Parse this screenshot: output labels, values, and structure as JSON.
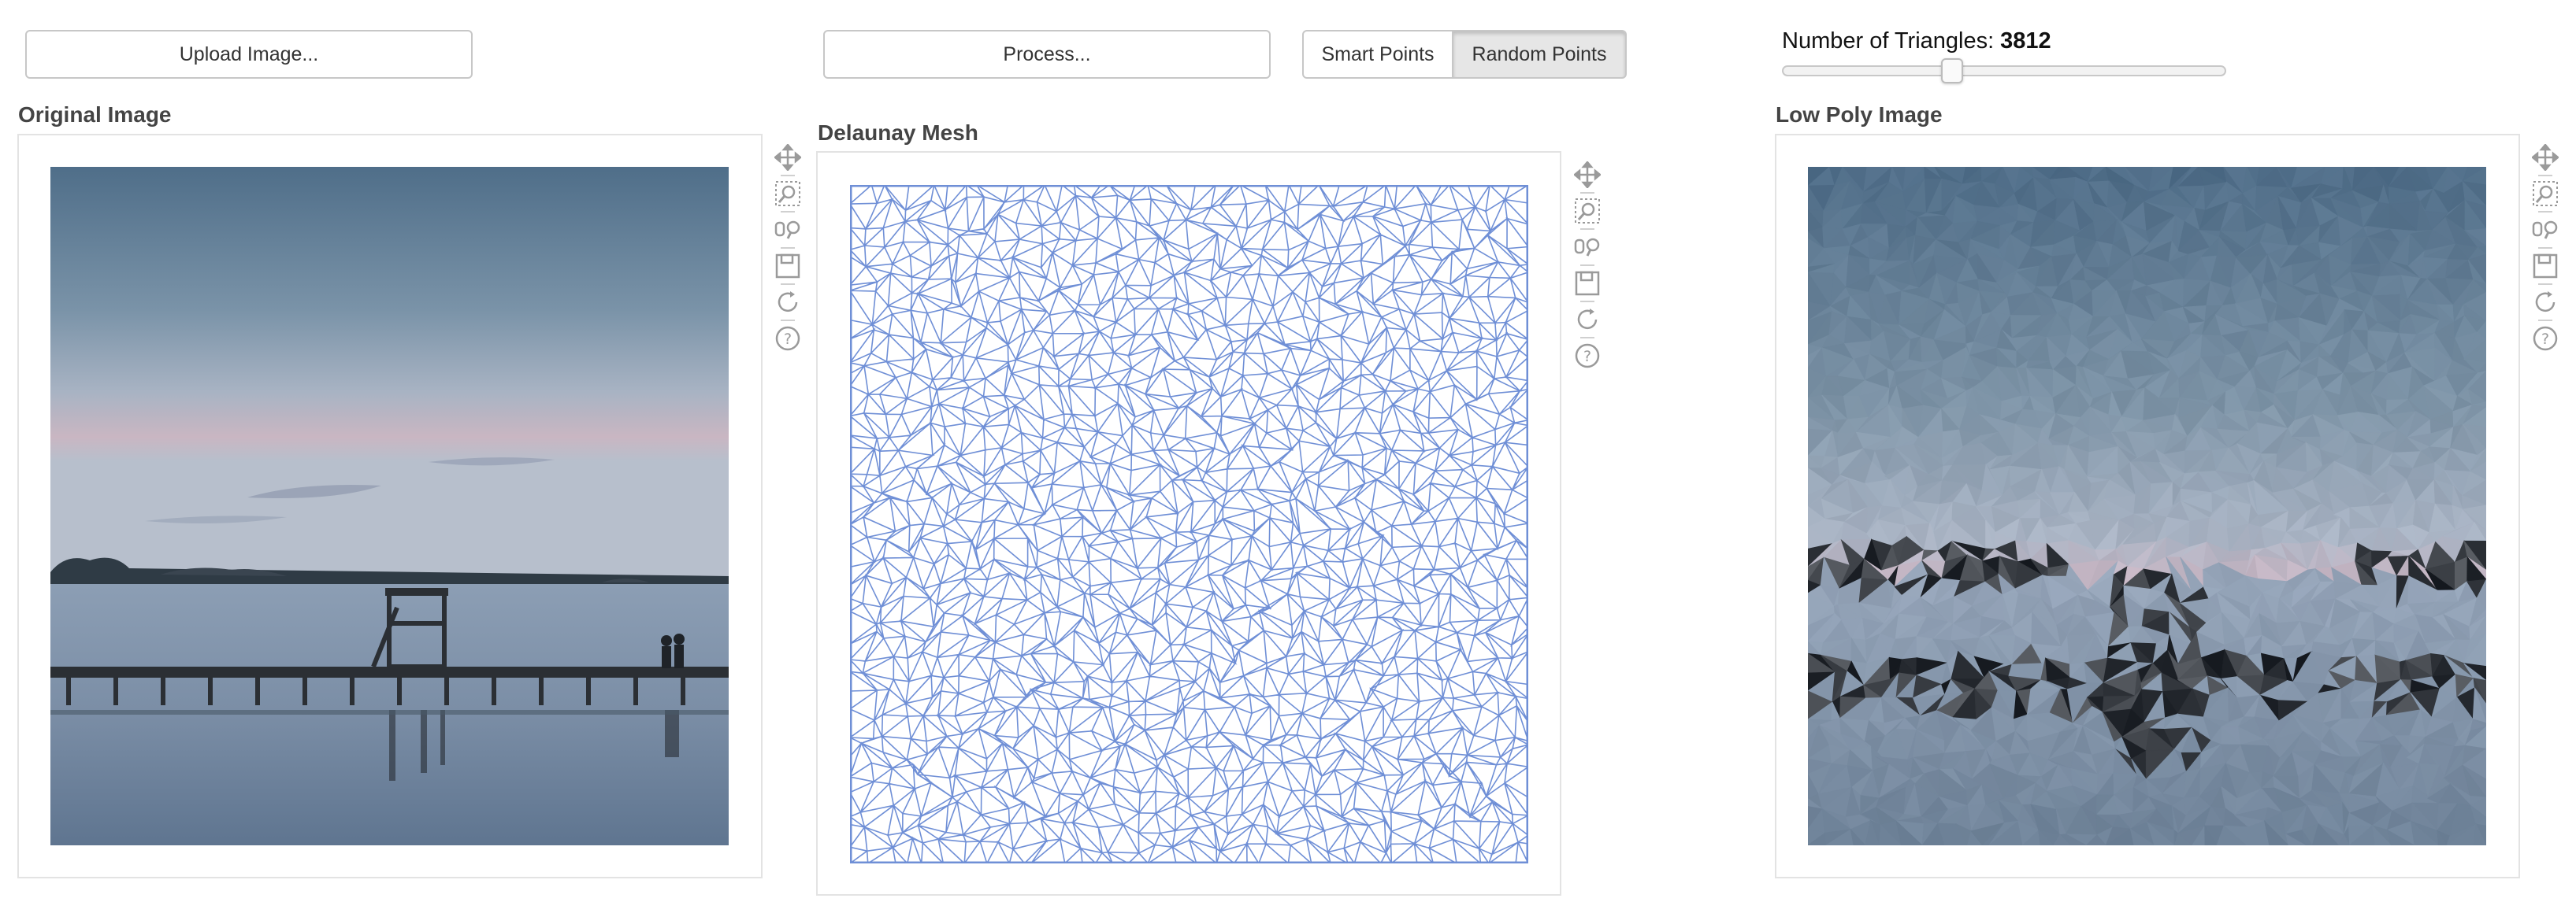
{
  "controls": {
    "upload_label": "Upload Image...",
    "process_label": "Process...",
    "point_modes": [
      "Smart Points",
      "Random Points"
    ],
    "selected_point_mode": "Random Points",
    "triangles_label": "Number of Triangles:",
    "triangles_value": "3812"
  },
  "panels": {
    "original_title": "Original Image",
    "mesh_title": "Delaunay Mesh",
    "lowpoly_title": "Low Poly Image"
  },
  "toolbar_icons": [
    "pan-icon",
    "box-zoom-icon",
    "wheel-zoom-icon",
    "save-icon",
    "reset-icon",
    "help-icon"
  ],
  "colors": {
    "mesh_line": "#6f8fd6",
    "button_border": "#c7c7c7",
    "active_toggle_bg": "#e6e6e6"
  }
}
